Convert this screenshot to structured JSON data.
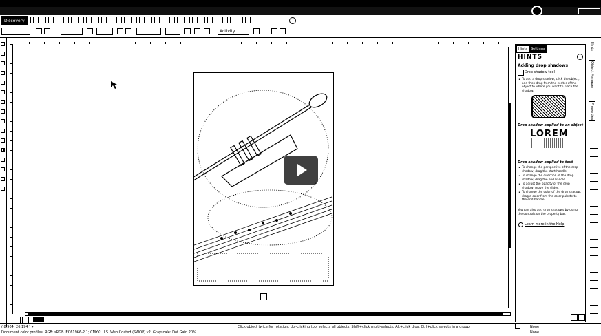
{
  "window": {
    "title": ""
  },
  "tabs": [
    {
      "label": "Discovery"
    },
    {
      "label": ""
    }
  ],
  "propbar": {
    "style_select": "Activity"
  },
  "docker": {
    "tabs": [
      "Hints",
      "Settings"
    ],
    "title": "HINTS",
    "heading": "Adding drop shadows",
    "tool_name": "Drop shadow tool",
    "hints": [
      "To add a drop shadow, click the object, and then drag from the center of the object to where you want to place the shadow.",
      "To change the perspective of the drop shadow, drag the start handle.",
      "To change the direction of the drop shadow, drag the end handle.",
      "To adjust the opacity of the drop shadow, move the slider.",
      "To change the color of the drop shadow, drag a color from the color palette to the end handle.",
      "You can also add drop shadows by using the controls on the property bar."
    ],
    "sub1": "Drop shadow applied to an object",
    "sub2": "Drop shadow applied to text",
    "lorem": "LOREM",
    "link": "Learn more in the Help"
  },
  "sidebar": {
    "labels": [
      "Hints",
      "Object Manager",
      "Properties"
    ]
  },
  "status": {
    "coords": "( 8.904, 26.194 )",
    "center": "Click object twice for rotation; dbl-clicking tool selects all objects; Shift+click multi-selects; Alt+click digs; Ctrl+click selects in a group",
    "profile": "Document color profiles: RGB: sRGB IEC61966-2.1; CMYK: U.S. Web Coated (SWOP) v2; Grayscale: Dot Gain 20%",
    "fill": "None",
    "outline": "None"
  },
  "colors": {
    "ink": "#000000",
    "paper": "#ffffff"
  }
}
